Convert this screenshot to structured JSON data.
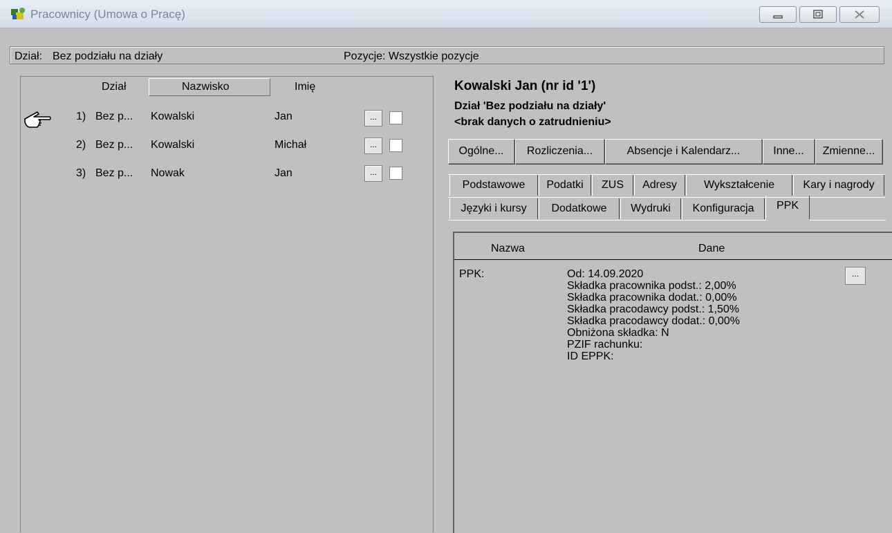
{
  "window": {
    "title": "Pracownicy (Umowa o Pracę)"
  },
  "header": {
    "dzial_label": "Dział:",
    "dzial_value": "Bez podziału na działy",
    "pozycje_text": "Pozycje: Wszystkie pozycje"
  },
  "list": {
    "columns": {
      "dzial": "Dział",
      "nazwisko": "Nazwisko",
      "imie": "Imię"
    },
    "rows": [
      {
        "num": "1)",
        "dzial": "Bez p...",
        "nazwisko": "Kowalski",
        "imie": "Jan",
        "dots": "..."
      },
      {
        "num": "2)",
        "dzial": "Bez p...",
        "nazwisko": "Kowalski",
        "imie": "Michał",
        "dots": "..."
      },
      {
        "num": "3)",
        "dzial": "Bez p...",
        "nazwisko": "Nowak",
        "imie": "Jan",
        "dots": "..."
      }
    ]
  },
  "employee": {
    "name": "Kowalski Jan (nr id '1')",
    "dept": "Dział 'Bez podziału na działy'",
    "employment": "<brak danych o zatrudnieniu>"
  },
  "main_tabs": [
    "Ogólne...",
    "Rozliczenia...",
    "Absencje i Kalendarz...",
    "Inne...",
    "Zmienne..."
  ],
  "sub_tabs_row1": [
    "Podstawowe",
    "Podatki",
    "ZUS",
    "Adresy",
    "Wykształcenie",
    "Kary i nagrody"
  ],
  "sub_tabs_row2": [
    "Języki i kursy",
    "Dodatkowe",
    "Wydruki",
    "Konfiguracja",
    "PPK"
  ],
  "data_table": {
    "col_name": "Nazwa",
    "col_data": "Dane",
    "row_label": "PPK:",
    "dots": "...",
    "lines": [
      "Od: 14.09.2020",
      "Składka pracownika podst.: 2,00%",
      "Składka pracownika dodat.: 0,00%",
      "Składka pracodawcy podst.: 1,50%",
      "Składka pracodawcy dodat.: 0,00%",
      "Obniżona składka: N",
      "PZIF rachunku:",
      "ID EPPK:"
    ]
  }
}
